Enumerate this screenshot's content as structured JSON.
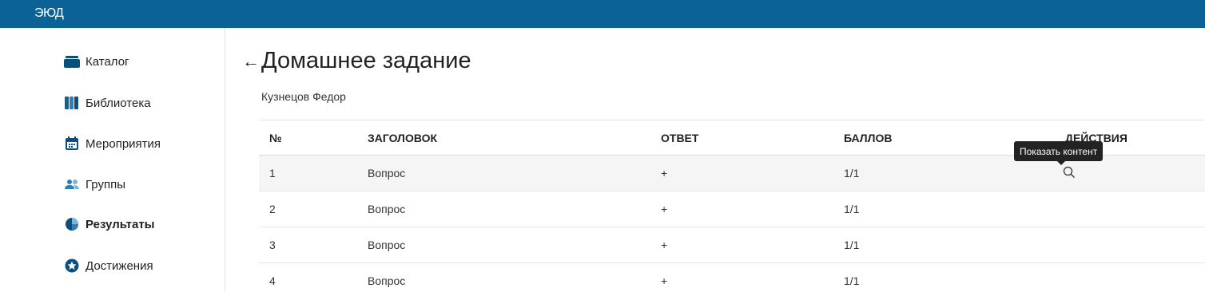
{
  "app": {
    "logo": "ЭЮД",
    "brand_color": "#0b6296"
  },
  "sidebar": {
    "items": [
      {
        "label": "Каталог",
        "icon": "catalog-icon",
        "active": false
      },
      {
        "label": "Библиотека",
        "icon": "library-icon",
        "active": false
      },
      {
        "label": "Мероприятия",
        "icon": "calendar-icon",
        "active": false
      },
      {
        "label": "Группы",
        "icon": "group-icon",
        "active": false
      },
      {
        "label": "Результаты",
        "icon": "results-pie-icon",
        "active": true
      },
      {
        "label": "Достижения",
        "icon": "achievement-star-icon",
        "active": false
      }
    ]
  },
  "main": {
    "back": "←",
    "title": "Домашнее задание",
    "subtitle": "Кузнецов Федор"
  },
  "table": {
    "headers": [
      "№",
      "ЗАГОЛОВОК",
      "ОТВЕТ",
      "БАЛЛОВ",
      "ДЕЙСТВИЯ"
    ],
    "rows": [
      {
        "num": "1",
        "title": "Вопрос",
        "answer": "+",
        "score": "1/1"
      },
      {
        "num": "2",
        "title": "Вопрос",
        "answer": "+",
        "score": "1/1"
      },
      {
        "num": "3",
        "title": "Вопрос",
        "answer": "+",
        "score": "1/1"
      },
      {
        "num": "4",
        "title": "Вопрос",
        "answer": "+",
        "score": "1/1"
      }
    ]
  },
  "tooltip": {
    "text": "Показать контент"
  }
}
